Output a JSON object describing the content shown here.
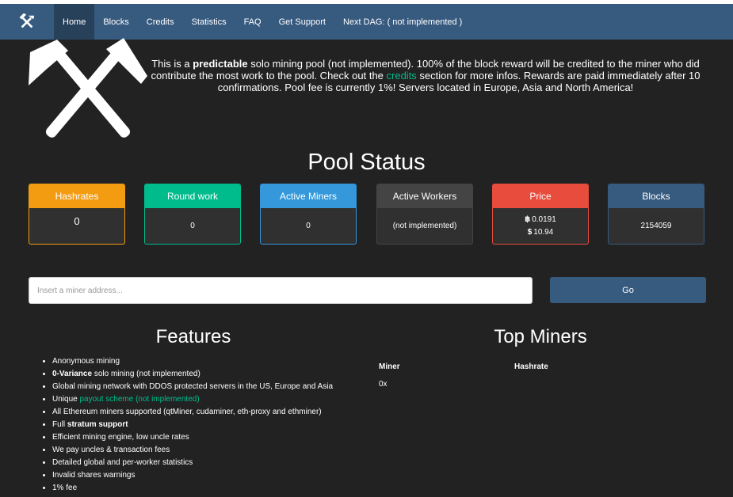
{
  "nav": {
    "brand_icon": "hammer-pickaxe-icon",
    "items": [
      {
        "label": "Home"
      },
      {
        "label": "Blocks"
      },
      {
        "label": "Credits"
      },
      {
        "label": "Statistics"
      },
      {
        "label": "FAQ"
      },
      {
        "label": "Get Support"
      },
      {
        "label": "Next DAG: ( not implemented )"
      }
    ]
  },
  "intro": {
    "part1": "This is a ",
    "strong": "predictable",
    "part2": " solo mining pool (not implemented). 100% of the block reward will be credited to the miner who did contribute the most work to the pool. Check out the ",
    "link": "credits",
    "part3": " section for more infos. Rewards are paid immediately after 10 confirmations. Pool fee is currently 1%! Servers located in Europe, Asia and North America!"
  },
  "pool_status": {
    "title": "Pool Status",
    "cards": [
      {
        "header": "Hashrates",
        "value": "0",
        "color": "#f39c12"
      },
      {
        "header": "Round work",
        "value": "0",
        "color": "#00bc8c"
      },
      {
        "header": "Active Miners",
        "value": "0",
        "color": "#3498db"
      },
      {
        "header": "Active Workers",
        "value": "(not implemented)",
        "color": "#444444"
      },
      {
        "header": "Price",
        "btc_symbol": "฿",
        "btc_value": "0.0191",
        "usd_symbol": "$",
        "usd_value": "10.94",
        "color": "#e74c3c"
      },
      {
        "header": "Blocks",
        "value": "2154059",
        "color": "#375a7f"
      }
    ]
  },
  "search": {
    "placeholder": "Insert a miner address...",
    "button_label": "Go"
  },
  "features": {
    "title": "Features",
    "items": [
      {
        "text": "Anonymous mining"
      },
      {
        "strong": "0-Variance",
        "text": " solo mining (not implemented)"
      },
      {
        "text": "Global mining network with DDOS protected servers in the US, Europe and Asia"
      },
      {
        "pre": "Unique ",
        "link": "payout scheme (not implemented)"
      },
      {
        "text": "All Ethereum miners supported (qtMiner, cudaminer, eth-proxy and ethminer)"
      },
      {
        "pre": "Full ",
        "strong": "stratum support"
      },
      {
        "text": "Efficient mining engine, low uncle rates"
      },
      {
        "text": "We pay uncles & transaction fees"
      },
      {
        "text": "Detailed global and per-worker statistics"
      },
      {
        "text": "Invalid shares warnings"
      },
      {
        "text": "1% fee"
      }
    ]
  },
  "top_miners": {
    "title": "Top Miners",
    "columns": [
      "Miner",
      "Hashrate"
    ],
    "rows": [
      {
        "miner": "0x",
        "hashrate": ""
      }
    ]
  }
}
